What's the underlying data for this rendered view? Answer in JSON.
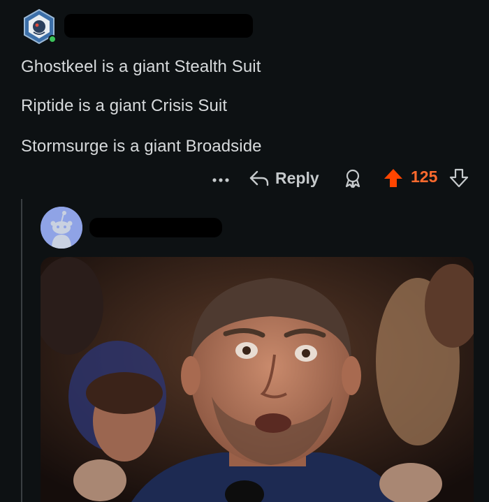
{
  "comment": {
    "lines": [
      "Ghostkeel is a giant Stealth Suit",
      "Riptide is a giant Crisis Suit",
      "Stormsurge is a giant Broadside"
    ],
    "actions": {
      "more_icon": "ellipsis-icon",
      "reply_label": "Reply",
      "reply_icon": "reply-arrow-icon",
      "award_icon": "award-icon",
      "upvote_icon": "upvote-arrow-icon",
      "score": "125",
      "downvote_icon": "downvote-arrow-icon"
    },
    "colors": {
      "upvoted": "#ff4500",
      "online": "#3cc45b"
    }
  },
  "reply": {
    "avatar": "snoo-avatar",
    "image_description": "reaction gif"
  }
}
